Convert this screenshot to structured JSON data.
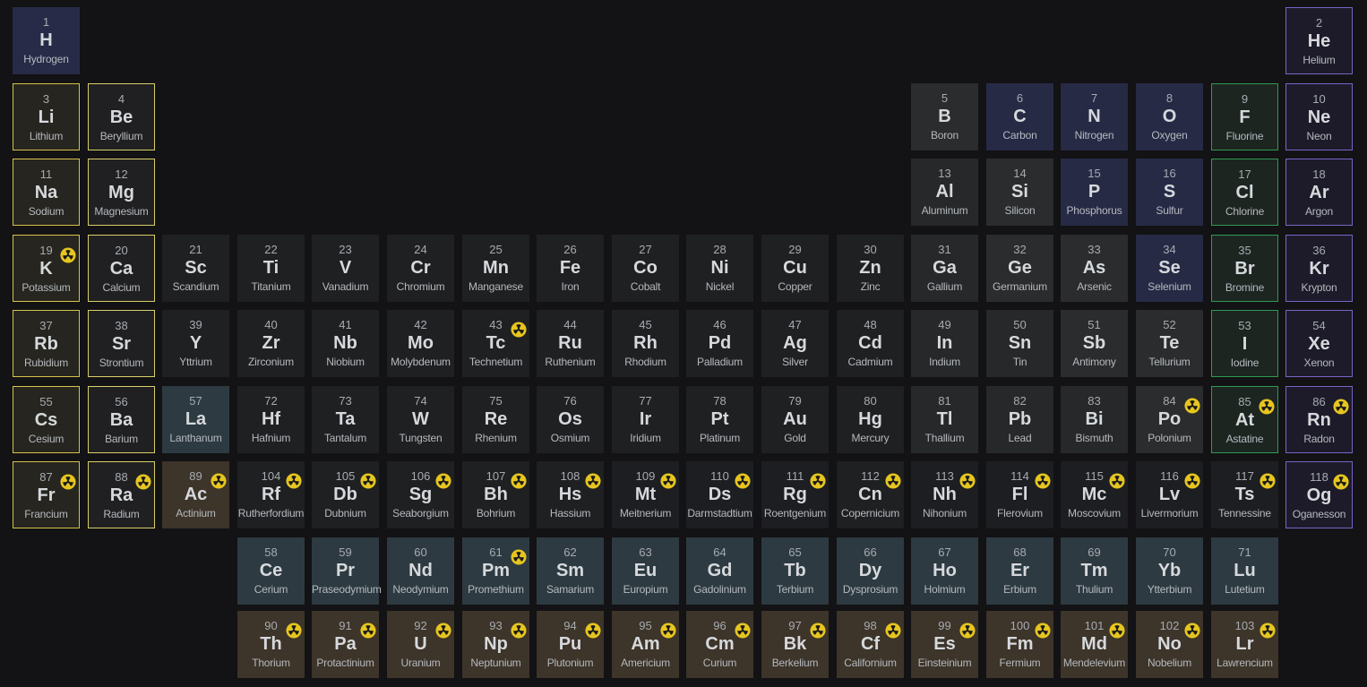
{
  "title": "",
  "elements": [
    {
      "z": 1,
      "s": "H",
      "n": "Hydrogen",
      "c": "hydrogen",
      "r": 1,
      "col": 1
    },
    {
      "z": 2,
      "s": "He",
      "n": "Helium",
      "c": "noble",
      "r": 1,
      "col": 18
    },
    {
      "z": 3,
      "s": "Li",
      "n": "Lithium",
      "c": "alkali",
      "r": 2,
      "col": 1
    },
    {
      "z": 4,
      "s": "Be",
      "n": "Beryllium",
      "c": "alkaline",
      "r": 2,
      "col": 2
    },
    {
      "z": 5,
      "s": "B",
      "n": "Boron",
      "c": "metalloid",
      "r": 2,
      "col": 13
    },
    {
      "z": 6,
      "s": "C",
      "n": "Carbon",
      "c": "nonmetal",
      "r": 2,
      "col": 14
    },
    {
      "z": 7,
      "s": "N",
      "n": "Nitrogen",
      "c": "nonmetal",
      "r": 2,
      "col": 15
    },
    {
      "z": 8,
      "s": "O",
      "n": "Oxygen",
      "c": "nonmetal",
      "r": 2,
      "col": 16
    },
    {
      "z": 9,
      "s": "F",
      "n": "Fluorine",
      "c": "halogen",
      "r": 2,
      "col": 17
    },
    {
      "z": 10,
      "s": "Ne",
      "n": "Neon",
      "c": "noble",
      "r": 2,
      "col": 18
    },
    {
      "z": 11,
      "s": "Na",
      "n": "Sodium",
      "c": "alkali",
      "r": 3,
      "col": 1
    },
    {
      "z": 12,
      "s": "Mg",
      "n": "Magnesium",
      "c": "alkaline",
      "r": 3,
      "col": 2
    },
    {
      "z": 13,
      "s": "Al",
      "n": "Aluminum",
      "c": "post",
      "r": 3,
      "col": 13
    },
    {
      "z": 14,
      "s": "Si",
      "n": "Silicon",
      "c": "metalloid",
      "r": 3,
      "col": 14
    },
    {
      "z": 15,
      "s": "P",
      "n": "Phosphorus",
      "c": "nonmetal",
      "r": 3,
      "col": 15
    },
    {
      "z": 16,
      "s": "S",
      "n": "Sulfur",
      "c": "nonmetal",
      "r": 3,
      "col": 16
    },
    {
      "z": 17,
      "s": "Cl",
      "n": "Chlorine",
      "c": "halogen",
      "r": 3,
      "col": 17
    },
    {
      "z": 18,
      "s": "Ar",
      "n": "Argon",
      "c": "noble",
      "r": 3,
      "col": 18
    },
    {
      "z": 19,
      "s": "K",
      "n": "Potassium",
      "c": "alkali",
      "r": 4,
      "col": 1,
      "rad": true
    },
    {
      "z": 20,
      "s": "Ca",
      "n": "Calcium",
      "c": "alkaline",
      "r": 4,
      "col": 2
    },
    {
      "z": 21,
      "s": "Sc",
      "n": "Scandium",
      "c": "transition",
      "r": 4,
      "col": 3
    },
    {
      "z": 22,
      "s": "Ti",
      "n": "Titanium",
      "c": "transition",
      "r": 4,
      "col": 4
    },
    {
      "z": 23,
      "s": "V",
      "n": "Vanadium",
      "c": "transition",
      "r": 4,
      "col": 5
    },
    {
      "z": 24,
      "s": "Cr",
      "n": "Chromium",
      "c": "transition",
      "r": 4,
      "col": 6
    },
    {
      "z": 25,
      "s": "Mn",
      "n": "Manganese",
      "c": "transition",
      "r": 4,
      "col": 7
    },
    {
      "z": 26,
      "s": "Fe",
      "n": "Iron",
      "c": "transition",
      "r": 4,
      "col": 8
    },
    {
      "z": 27,
      "s": "Co",
      "n": "Cobalt",
      "c": "transition",
      "r": 4,
      "col": 9
    },
    {
      "z": 28,
      "s": "Ni",
      "n": "Nickel",
      "c": "transition",
      "r": 4,
      "col": 10
    },
    {
      "z": 29,
      "s": "Cu",
      "n": "Copper",
      "c": "transition",
      "r": 4,
      "col": 11
    },
    {
      "z": 30,
      "s": "Zn",
      "n": "Zinc",
      "c": "transition",
      "r": 4,
      "col": 12
    },
    {
      "z": 31,
      "s": "Ga",
      "n": "Gallium",
      "c": "post",
      "r": 4,
      "col": 13
    },
    {
      "z": 32,
      "s": "Ge",
      "n": "Germanium",
      "c": "metalloid",
      "r": 4,
      "col": 14
    },
    {
      "z": 33,
      "s": "As",
      "n": "Arsenic",
      "c": "metalloid",
      "r": 4,
      "col": 15
    },
    {
      "z": 34,
      "s": "Se",
      "n": "Selenium",
      "c": "nonmetal",
      "r": 4,
      "col": 16
    },
    {
      "z": 35,
      "s": "Br",
      "n": "Bromine",
      "c": "halogen",
      "r": 4,
      "col": 17
    },
    {
      "z": 36,
      "s": "Kr",
      "n": "Krypton",
      "c": "noble",
      "r": 4,
      "col": 18
    },
    {
      "z": 37,
      "s": "Rb",
      "n": "Rubidium",
      "c": "alkali",
      "r": 5,
      "col": 1
    },
    {
      "z": 38,
      "s": "Sr",
      "n": "Strontium",
      "c": "alkaline",
      "r": 5,
      "col": 2
    },
    {
      "z": 39,
      "s": "Y",
      "n": "Yttrium",
      "c": "transition",
      "r": 5,
      "col": 3
    },
    {
      "z": 40,
      "s": "Zr",
      "n": "Zirconium",
      "c": "transition",
      "r": 5,
      "col": 4
    },
    {
      "z": 41,
      "s": "Nb",
      "n": "Niobium",
      "c": "transition",
      "r": 5,
      "col": 5
    },
    {
      "z": 42,
      "s": "Mo",
      "n": "Molybdenum",
      "c": "transition",
      "r": 5,
      "col": 6
    },
    {
      "z": 43,
      "s": "Tc",
      "n": "Technetium",
      "c": "transition",
      "r": 5,
      "col": 7,
      "rad": true
    },
    {
      "z": 44,
      "s": "Ru",
      "n": "Ruthenium",
      "c": "transition",
      "r": 5,
      "col": 8
    },
    {
      "z": 45,
      "s": "Rh",
      "n": "Rhodium",
      "c": "transition",
      "r": 5,
      "col": 9
    },
    {
      "z": 46,
      "s": "Pd",
      "n": "Palladium",
      "c": "transition",
      "r": 5,
      "col": 10
    },
    {
      "z": 47,
      "s": "Ag",
      "n": "Silver",
      "c": "transition",
      "r": 5,
      "col": 11
    },
    {
      "z": 48,
      "s": "Cd",
      "n": "Cadmium",
      "c": "transition",
      "r": 5,
      "col": 12
    },
    {
      "z": 49,
      "s": "In",
      "n": "Indium",
      "c": "post",
      "r": 5,
      "col": 13
    },
    {
      "z": 50,
      "s": "Sn",
      "n": "Tin",
      "c": "post",
      "r": 5,
      "col": 14
    },
    {
      "z": 51,
      "s": "Sb",
      "n": "Antimony",
      "c": "metalloid",
      "r": 5,
      "col": 15
    },
    {
      "z": 52,
      "s": "Te",
      "n": "Tellurium",
      "c": "metalloid",
      "r": 5,
      "col": 16
    },
    {
      "z": 53,
      "s": "I",
      "n": "Iodine",
      "c": "halogen",
      "r": 5,
      "col": 17
    },
    {
      "z": 54,
      "s": "Xe",
      "n": "Xenon",
      "c": "noble",
      "r": 5,
      "col": 18
    },
    {
      "z": 55,
      "s": "Cs",
      "n": "Cesium",
      "c": "alkali",
      "r": 6,
      "col": 1
    },
    {
      "z": 56,
      "s": "Ba",
      "n": "Barium",
      "c": "alkaline",
      "r": 6,
      "col": 2
    },
    {
      "z": 57,
      "s": "La",
      "n": "Lanthanum",
      "c": "lanthanide",
      "r": 6,
      "col": 3
    },
    {
      "z": 72,
      "s": "Hf",
      "n": "Hafnium",
      "c": "transition",
      "r": 6,
      "col": 4
    },
    {
      "z": 73,
      "s": "Ta",
      "n": "Tantalum",
      "c": "transition",
      "r": 6,
      "col": 5
    },
    {
      "z": 74,
      "s": "W",
      "n": "Tungsten",
      "c": "transition",
      "r": 6,
      "col": 6
    },
    {
      "z": 75,
      "s": "Re",
      "n": "Rhenium",
      "c": "transition",
      "r": 6,
      "col": 7
    },
    {
      "z": 76,
      "s": "Os",
      "n": "Osmium",
      "c": "transition",
      "r": 6,
      "col": 8
    },
    {
      "z": 77,
      "s": "Ir",
      "n": "Iridium",
      "c": "transition",
      "r": 6,
      "col": 9
    },
    {
      "z": 78,
      "s": "Pt",
      "n": "Platinum",
      "c": "transition",
      "r": 6,
      "col": 10
    },
    {
      "z": 79,
      "s": "Au",
      "n": "Gold",
      "c": "transition",
      "r": 6,
      "col": 11
    },
    {
      "z": 80,
      "s": "Hg",
      "n": "Mercury",
      "c": "transition",
      "r": 6,
      "col": 12
    },
    {
      "z": 81,
      "s": "Tl",
      "n": "Thallium",
      "c": "post",
      "r": 6,
      "col": 13
    },
    {
      "z": 82,
      "s": "Pb",
      "n": "Lead",
      "c": "post",
      "r": 6,
      "col": 14
    },
    {
      "z": 83,
      "s": "Bi",
      "n": "Bismuth",
      "c": "post",
      "r": 6,
      "col": 15
    },
    {
      "z": 84,
      "s": "Po",
      "n": "Polonium",
      "c": "metalloid",
      "r": 6,
      "col": 16,
      "rad": true
    },
    {
      "z": 85,
      "s": "At",
      "n": "Astatine",
      "c": "halogen",
      "r": 6,
      "col": 17,
      "rad": true
    },
    {
      "z": 86,
      "s": "Rn",
      "n": "Radon",
      "c": "noble",
      "r": 6,
      "col": 18,
      "rad": true
    },
    {
      "z": 87,
      "s": "Fr",
      "n": "Francium",
      "c": "alkali",
      "r": 7,
      "col": 1,
      "rad": true
    },
    {
      "z": 88,
      "s": "Ra",
      "n": "Radium",
      "c": "alkaline",
      "r": 7,
      "col": 2,
      "rad": true
    },
    {
      "z": 89,
      "s": "Ac",
      "n": "Actinium",
      "c": "actinide",
      "r": 7,
      "col": 3,
      "rad": true
    },
    {
      "z": 104,
      "s": "Rf",
      "n": "Rutherfordium",
      "c": "transition",
      "r": 7,
      "col": 4,
      "rad": true
    },
    {
      "z": 105,
      "s": "Db",
      "n": "Dubnium",
      "c": "transition",
      "r": 7,
      "col": 5,
      "rad": true
    },
    {
      "z": 106,
      "s": "Sg",
      "n": "Seaborgium",
      "c": "transition",
      "r": 7,
      "col": 6,
      "rad": true
    },
    {
      "z": 107,
      "s": "Bh",
      "n": "Bohrium",
      "c": "transition",
      "r": 7,
      "col": 7,
      "rad": true
    },
    {
      "z": 108,
      "s": "Hs",
      "n": "Hassium",
      "c": "transition",
      "r": 7,
      "col": 8,
      "rad": true
    },
    {
      "z": 109,
      "s": "Mt",
      "n": "Meitnerium",
      "c": "unknown",
      "r": 7,
      "col": 9,
      "rad": true
    },
    {
      "z": 110,
      "s": "Ds",
      "n": "Darmstadtium",
      "c": "unknown",
      "r": 7,
      "col": 10,
      "rad": true
    },
    {
      "z": 111,
      "s": "Rg",
      "n": "Roentgenium",
      "c": "unknown",
      "r": 7,
      "col": 11,
      "rad": true
    },
    {
      "z": 112,
      "s": "Cn",
      "n": "Copernicium",
      "c": "transition",
      "r": 7,
      "col": 12,
      "rad": true
    },
    {
      "z": 113,
      "s": "Nh",
      "n": "Nihonium",
      "c": "unknown",
      "r": 7,
      "col": 13,
      "rad": true
    },
    {
      "z": 114,
      "s": "Fl",
      "n": "Flerovium",
      "c": "unknown",
      "r": 7,
      "col": 14,
      "rad": true
    },
    {
      "z": 115,
      "s": "Mc",
      "n": "Moscovium",
      "c": "unknown",
      "r": 7,
      "col": 15,
      "rad": true
    },
    {
      "z": 116,
      "s": "Lv",
      "n": "Livermorium",
      "c": "unknown",
      "r": 7,
      "col": 16,
      "rad": true
    },
    {
      "z": 117,
      "s": "Ts",
      "n": "Tennessine",
      "c": "unknown",
      "r": 7,
      "col": 17,
      "rad": true
    },
    {
      "z": 118,
      "s": "Og",
      "n": "Oganesson",
      "c": "noble",
      "r": 7,
      "col": 18,
      "rad": true
    },
    {
      "z": 58,
      "s": "Ce",
      "n": "Cerium",
      "c": "lanthanide",
      "r": 8,
      "col": 4
    },
    {
      "z": 59,
      "s": "Pr",
      "n": "Praseodymium",
      "c": "lanthanide",
      "r": 8,
      "col": 5
    },
    {
      "z": 60,
      "s": "Nd",
      "n": "Neodymium",
      "c": "lanthanide",
      "r": 8,
      "col": 6
    },
    {
      "z": 61,
      "s": "Pm",
      "n": "Promethium",
      "c": "lanthanide",
      "r": 8,
      "col": 7,
      "rad": true
    },
    {
      "z": 62,
      "s": "Sm",
      "n": "Samarium",
      "c": "lanthanide",
      "r": 8,
      "col": 8
    },
    {
      "z": 63,
      "s": "Eu",
      "n": "Europium",
      "c": "lanthanide",
      "r": 8,
      "col": 9
    },
    {
      "z": 64,
      "s": "Gd",
      "n": "Gadolinium",
      "c": "lanthanide",
      "r": 8,
      "col": 10
    },
    {
      "z": 65,
      "s": "Tb",
      "n": "Terbium",
      "c": "lanthanide",
      "r": 8,
      "col": 11
    },
    {
      "z": 66,
      "s": "Dy",
      "n": "Dysprosium",
      "c": "lanthanide",
      "r": 8,
      "col": 12
    },
    {
      "z": 67,
      "s": "Ho",
      "n": "Holmium",
      "c": "lanthanide",
      "r": 8,
      "col": 13
    },
    {
      "z": 68,
      "s": "Er",
      "n": "Erbium",
      "c": "lanthanide",
      "r": 8,
      "col": 14
    },
    {
      "z": 69,
      "s": "Tm",
      "n": "Thulium",
      "c": "lanthanide",
      "r": 8,
      "col": 15
    },
    {
      "z": 70,
      "s": "Yb",
      "n": "Ytterbium",
      "c": "lanthanide",
      "r": 8,
      "col": 16
    },
    {
      "z": 71,
      "s": "Lu",
      "n": "Lutetium",
      "c": "lanthanide",
      "r": 8,
      "col": 17
    },
    {
      "z": 90,
      "s": "Th",
      "n": "Thorium",
      "c": "actinide",
      "r": 9,
      "col": 4,
      "rad": true
    },
    {
      "z": 91,
      "s": "Pa",
      "n": "Protactinium",
      "c": "actinide",
      "r": 9,
      "col": 5,
      "rad": true
    },
    {
      "z": 92,
      "s": "U",
      "n": "Uranium",
      "c": "actinide",
      "r": 9,
      "col": 6,
      "rad": true
    },
    {
      "z": 93,
      "s": "Np",
      "n": "Neptunium",
      "c": "actinide",
      "r": 9,
      "col": 7,
      "rad": true
    },
    {
      "z": 94,
      "s": "Pu",
      "n": "Plutonium",
      "c": "actinide",
      "r": 9,
      "col": 8,
      "rad": true
    },
    {
      "z": 95,
      "s": "Am",
      "n": "Americium",
      "c": "actinide",
      "r": 9,
      "col": 9,
      "rad": true
    },
    {
      "z": 96,
      "s": "Cm",
      "n": "Curium",
      "c": "actinide",
      "r": 9,
      "col": 10,
      "rad": true
    },
    {
      "z": 97,
      "s": "Bk",
      "n": "Berkelium",
      "c": "actinide",
      "r": 9,
      "col": 11,
      "rad": true
    },
    {
      "z": 98,
      "s": "Cf",
      "n": "Californium",
      "c": "actinide",
      "r": 9,
      "col": 12,
      "rad": true
    },
    {
      "z": 99,
      "s": "Es",
      "n": "Einsteinium",
      "c": "actinide",
      "r": 9,
      "col": 13,
      "rad": true
    },
    {
      "z": 100,
      "s": "Fm",
      "n": "Fermium",
      "c": "actinide",
      "r": 9,
      "col": 14,
      "rad": true
    },
    {
      "z": 101,
      "s": "Md",
      "n": "Mendelevium",
      "c": "actinide",
      "r": 9,
      "col": 15,
      "rad": true
    },
    {
      "z": 102,
      "s": "No",
      "n": "Nobelium",
      "c": "actinide",
      "r": 9,
      "col": 16,
      "rad": true
    },
    {
      "z": 103,
      "s": "Lr",
      "n": "Lawrencium",
      "c": "actinide",
      "r": 9,
      "col": 17,
      "rad": true
    }
  ],
  "colors": {
    "background": "#131214",
    "radiation_icon": "#e6c51f"
  },
  "icons": {
    "radioactive": "radioactive-icon"
  }
}
